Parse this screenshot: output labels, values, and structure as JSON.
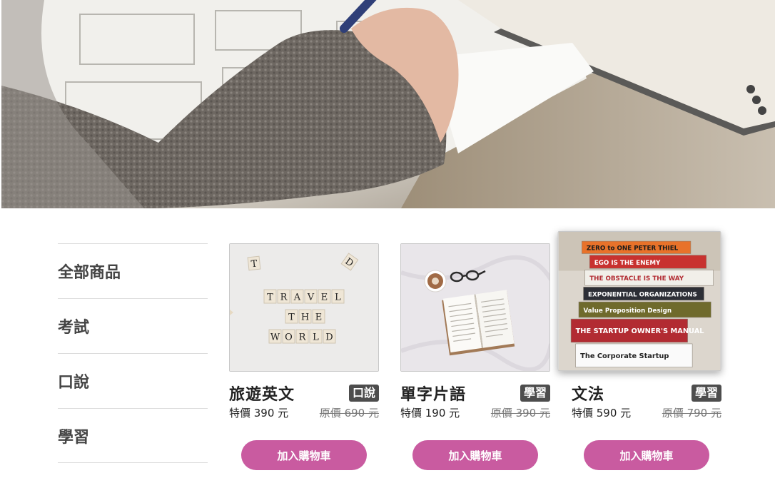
{
  "sidebar": {
    "items": [
      {
        "label": "全部商品"
      },
      {
        "label": "考試"
      },
      {
        "label": "口說"
      },
      {
        "label": "學習"
      }
    ]
  },
  "products": [
    {
      "name": "旅遊英文",
      "tag": "口說",
      "sale": "特價 390 元",
      "original": "原價 690 元",
      "button": "加入購物車"
    },
    {
      "name": "單字片語",
      "tag": "學習",
      "sale": "特價 190 元",
      "original": "原價 390 元",
      "button": "加入購物車"
    },
    {
      "name": "文法",
      "tag": "學習",
      "sale": "特價 590 元",
      "original": "原價 790 元",
      "button": "加入購物車"
    }
  ],
  "images": {
    "tiles_top": [
      "T",
      "D"
    ],
    "tiles_rows": [
      "TRAVEL",
      "THE",
      "WORLD"
    ],
    "book_spines": [
      "ZERO to ONE   PETER THIEL",
      "EGO IS THE ENEMY",
      "THE OBSTACLE IS THE WAY",
      "EXPONENTIAL ORGANIZATIONS",
      "Value Proposition Design",
      "THE STARTUP OWNER'S MANUAL",
      "The Corporate Startup"
    ]
  },
  "colors": {
    "accent": "#c95ba0",
    "tag_bg": "#4d4d4d"
  }
}
